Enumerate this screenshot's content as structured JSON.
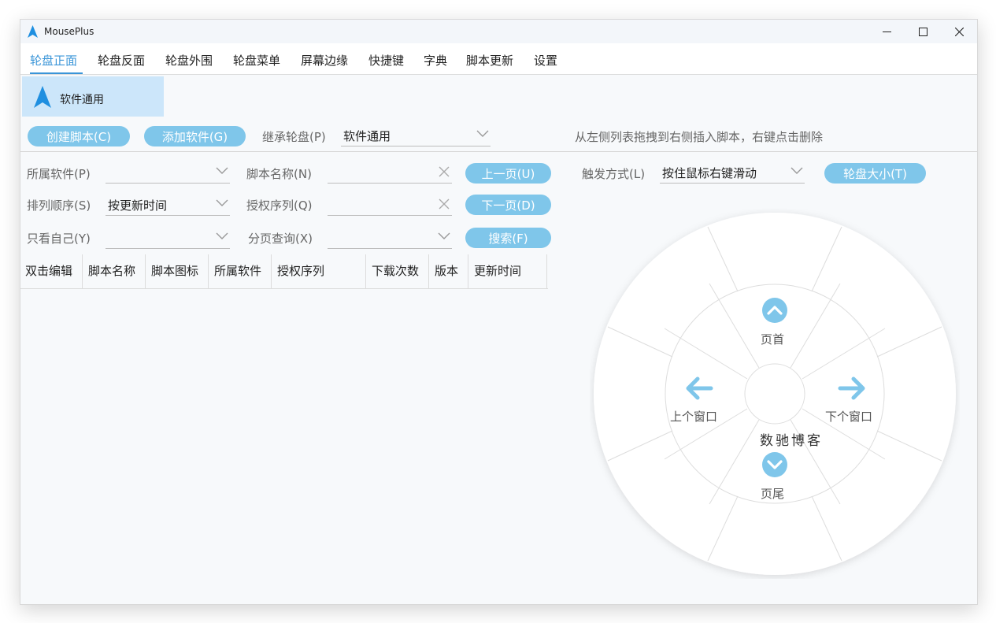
{
  "window": {
    "title": "MousePlus"
  },
  "menu": {
    "items": [
      {
        "label": "轮盘正面"
      },
      {
        "label": "轮盘反面"
      },
      {
        "label": "轮盘外围"
      },
      {
        "label": "轮盘菜单"
      },
      {
        "label": "屏幕边缘"
      },
      {
        "label": "快捷键"
      },
      {
        "label": "字典"
      },
      {
        "label": "脚本更新"
      },
      {
        "label": "设置"
      }
    ]
  },
  "sidebar": {
    "selected_item": "软件通用"
  },
  "toolbar": {
    "create_script": "创建脚本(C)",
    "add_software": "添加软件(G)",
    "inherit_label": "继承轮盘(P)",
    "inherit_value": "软件通用",
    "hint": "从左侧列表拖拽到右侧插入脚本，右键点击删除"
  },
  "filters": {
    "software_label": "所属软件(P)",
    "software_value": "",
    "name_label": "脚本名称(N)",
    "name_value": "",
    "prev_page": "上一页(U)",
    "sort_label": "排列顺序(S)",
    "sort_value": "按更新时间",
    "auth_label": "授权序列(Q)",
    "auth_value": "",
    "next_page": "下一页(D)",
    "mine_label": "只看自己(Y)",
    "mine_value": "",
    "page_label": "分页查询(X)",
    "page_value": "",
    "search": "搜索(F)"
  },
  "table": {
    "columns": [
      "双击编辑",
      "脚本名称",
      "脚本图标",
      "所属软件",
      "授权序列",
      "下载次数",
      "版本",
      "更新时间"
    ]
  },
  "trigger": {
    "label": "触发方式(L)",
    "value": "按住鼠标右键滑动",
    "size_button": "轮盘大小(T)"
  },
  "wheel": {
    "top": "页首",
    "left": "上个窗口",
    "right": "下个窗口",
    "bottom": "页尾",
    "brand": "数驰博客",
    "accent": "#7fc6ea"
  }
}
